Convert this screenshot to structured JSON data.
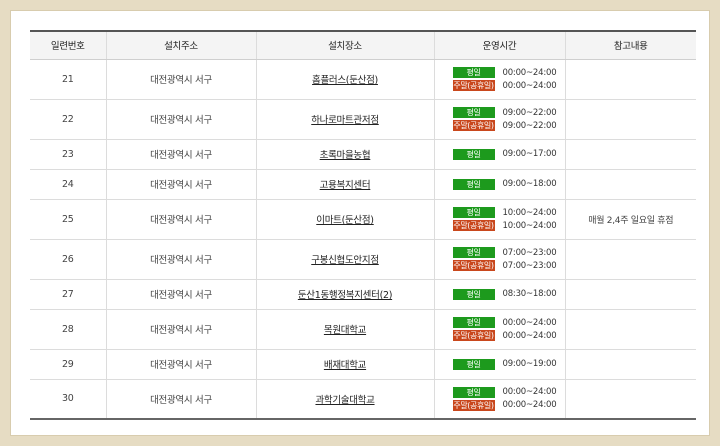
{
  "headers": [
    "일련번호",
    "설치주소",
    "설치장소",
    "운영시간",
    "참고내용"
  ],
  "labels": {
    "weekday": "평일",
    "weekend": "주말(공휴일)"
  },
  "rows": [
    {
      "no": "21",
      "address": "대전광역시 서구",
      "place": "홈플러스(둔산점)",
      "weekday": "00:00~24:00",
      "weekend": "00:00~24:00",
      "note": ""
    },
    {
      "no": "22",
      "address": "대전광역시 서구",
      "place": "하나로마트관저점",
      "weekday": "09:00~22:00",
      "weekend": "09:00~22:00",
      "note": ""
    },
    {
      "no": "23",
      "address": "대전광역시 서구",
      "place": "초록마을농협",
      "weekday": "09:00~17:00",
      "weekend": null,
      "note": ""
    },
    {
      "no": "24",
      "address": "대전광역시 서구",
      "place": "고용복지센터",
      "weekday": "09:00~18:00",
      "weekend": null,
      "note": ""
    },
    {
      "no": "25",
      "address": "대전광역시 서구",
      "place": "이마트(둔산점)",
      "weekday": "10:00~24:00",
      "weekend": "10:00~24:00",
      "note": "매월 2,4주 일요일 휴점"
    },
    {
      "no": "26",
      "address": "대전광역시 서구",
      "place": "구봉신협도안지점",
      "weekday": "07:00~23:00",
      "weekend": "07:00~23:00",
      "note": ""
    },
    {
      "no": "27",
      "address": "대전광역시 서구",
      "place": "둔산1동행정복지센터(2)",
      "weekday": "08:30~18:00",
      "weekend": null,
      "note": ""
    },
    {
      "no": "28",
      "address": "대전광역시 서구",
      "place": "목원대학교",
      "weekday": "00:00~24:00",
      "weekend": "00:00~24:00",
      "note": ""
    },
    {
      "no": "29",
      "address": "대전광역시 서구",
      "place": "배재대학교",
      "weekday": "09:00~19:00",
      "weekend": null,
      "note": ""
    },
    {
      "no": "30",
      "address": "대전광역시 서구",
      "place": "과학기술대학교",
      "weekday": "00:00~24:00",
      "weekend": "00:00~24:00",
      "note": ""
    }
  ],
  "colors": {
    "weekday_badge": "#1d9a1d",
    "weekend_badge": "#c9471c",
    "frame": "#e6dcc3"
  }
}
